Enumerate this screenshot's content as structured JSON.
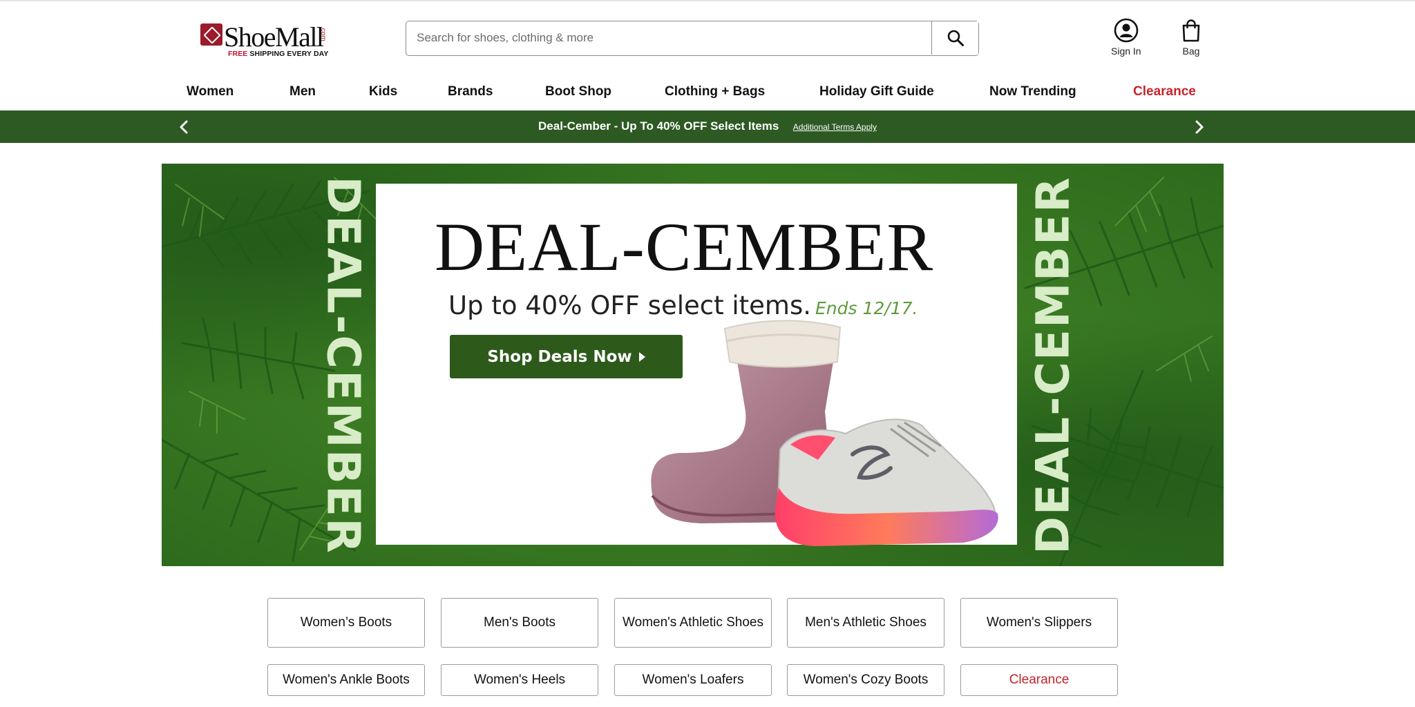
{
  "header": {
    "logo": {
      "name": "ShoeMall",
      "com": ".com",
      "tag_red": "FREE",
      "tag_rest": " SHIPPING EVERY DAY"
    },
    "search": {
      "placeholder": "Search for shoes, clothing & more",
      "value": ""
    },
    "account": {
      "sign_in": "Sign In",
      "bag": "Bag"
    }
  },
  "nav": {
    "items": [
      "Women",
      "Men",
      "Kids",
      "Brands",
      "Boot Shop",
      "Clothing + Bags",
      "Holiday Gift Guide",
      "Now Trending",
      "Clearance"
    ]
  },
  "promo": {
    "text": "Deal-Cember - Up To 40% OFF Select Items",
    "link": "Additional Terms Apply"
  },
  "hero": {
    "side_text": "DEAL-CEMBER",
    "title": "DEAL-CEMBER",
    "subtitle": "Up to 40% OFF select items.",
    "ends": "Ends 12/17.",
    "cta": "Shop Deals Now"
  },
  "categories": {
    "row1": [
      "Women’s Boots",
      "Men's Boots",
      "Women's Athletic Shoes",
      "Men's Athletic Shoes",
      "Women's Slippers"
    ],
    "row2": [
      "Women's Ankle Boots",
      "Women's Heels",
      "Women's Loafers",
      "Women's Cozy Boots",
      "Clearance"
    ]
  },
  "colors": {
    "promo_bar": "#2d5a23",
    "accent_red": "#c8232c",
    "hero_green": "#3a7a22",
    "cta_green": "#2d5a1b"
  },
  "icons": [
    "search-icon",
    "user-circle-icon",
    "shopping-bag-icon",
    "chevron-left-icon",
    "chevron-right-icon",
    "play-triangle-icon"
  ]
}
